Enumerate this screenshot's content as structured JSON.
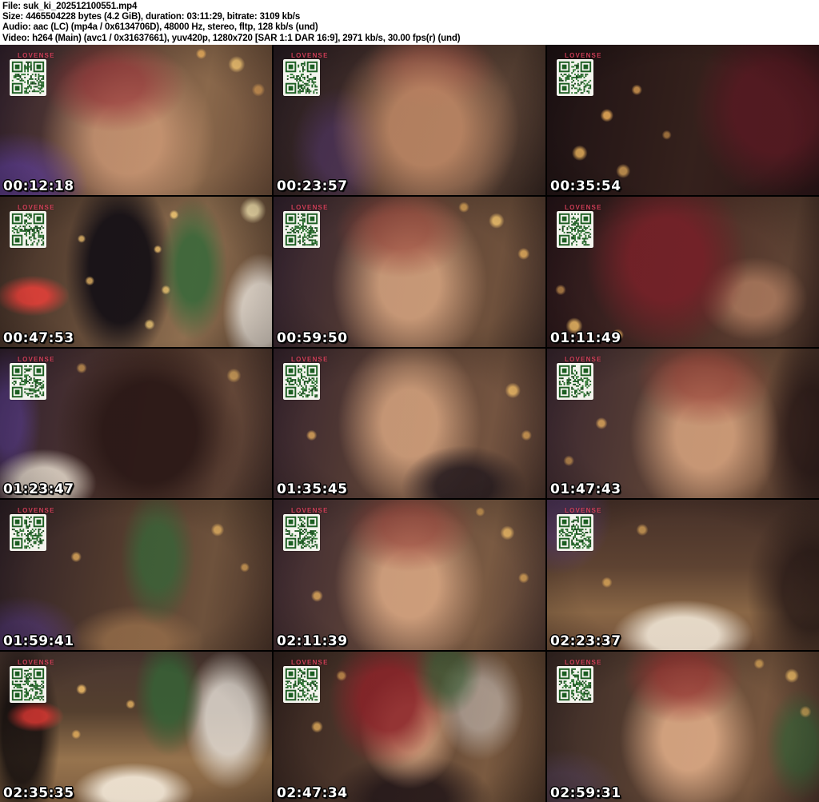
{
  "header": {
    "lines": [
      "File: suk_ki_202512100551.mp4",
      "Size: 4465504228 bytes (4.2 GiB), duration: 03:11:29, bitrate: 3109 kb/s",
      "Audio: aac (LC) (mp4a / 0x6134706D), 48000 Hz, stereo, fltp, 128 kb/s (und)",
      "Video: h264 (Main) (avc1 / 0x31637661), yuv420p, 1280x720 [SAR 1:1 DAR 16:9], 2971 kb/s, 30.00 fps(r) (und)"
    ]
  },
  "watermark": "LOVENSE",
  "colors": {
    "header_bg": "#ffffff",
    "header_text": "#000000",
    "sheet_bg": "#000000",
    "timestamp_text": "#ffffff",
    "timestamp_outline": "#000000",
    "watermark_pink": "#e0425e",
    "qr_module_green": "#1c5e22",
    "bokeh_gold": "#f5c15e"
  },
  "thumbnails": [
    {
      "timestamp": "00:12:18",
      "scene": "closeup-portrait-warm-purple"
    },
    {
      "timestamp": "00:23:57",
      "scene": "closeup-warm-dark"
    },
    {
      "timestamp": "00:35:54",
      "scene": "dark-golden-bokeh"
    },
    {
      "timestamp": "00:47:53",
      "scene": "room-christmas-tree-neon-chill"
    },
    {
      "timestamp": "00:59:50",
      "scene": "portrait-warm-bokeh"
    },
    {
      "timestamp": "01:11:49",
      "scene": "red-hair-closeup"
    },
    {
      "timestamp": "01:23:47",
      "scene": "dark-center-bokeh-fur"
    },
    {
      "timestamp": "01:35:45",
      "scene": "portrait-warm-bokeh"
    },
    {
      "timestamp": "01:47:43",
      "scene": "portrait-warm-bokeh"
    },
    {
      "timestamp": "01:59:41",
      "scene": "room-tree-bokeh"
    },
    {
      "timestamp": "02:11:39",
      "scene": "portrait-warm-bokeh"
    },
    {
      "timestamp": "02:23:37",
      "scene": "room-floor-fur-rug"
    },
    {
      "timestamp": "02:35:35",
      "scene": "room-wide-tree-dresser"
    },
    {
      "timestamp": "02:47:34",
      "scene": "portrait-room-choker"
    },
    {
      "timestamp": "02:59:31",
      "scene": "portrait-room-tree"
    }
  ]
}
